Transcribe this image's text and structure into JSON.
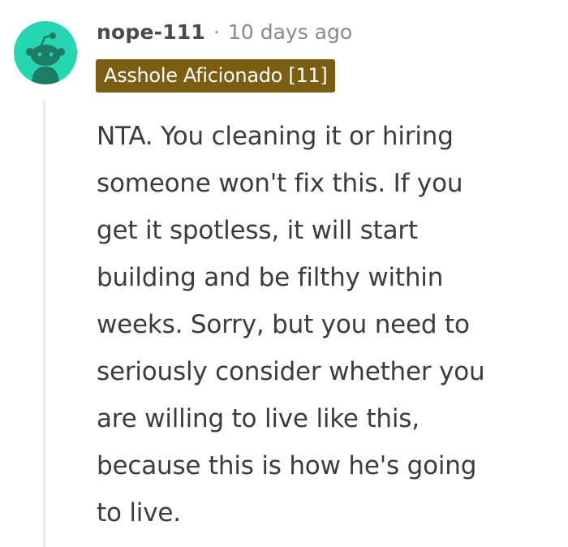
{
  "comment": {
    "author": "nope-111",
    "separator": "·",
    "time_ago": "10 days ago",
    "flair": "Asshole Aficionado [11]",
    "body_lines": [
      "NTA. You cleaning it or hiring",
      "someone won't fix this. If you",
      "get it spotless, it will start",
      "building and be filthy within",
      "weeks. Sorry, but you need to",
      "seriously consider whether you",
      "are willing to live like this,",
      "because this is how he's going",
      "to live."
    ]
  },
  "colors": {
    "avatar_bg": "#26d6b2",
    "avatar_figure": "#1b7d66",
    "flair_bg": "#7b5e12",
    "thread_line": "#e9eaeb"
  },
  "avatar_icon": "snoo-icon"
}
